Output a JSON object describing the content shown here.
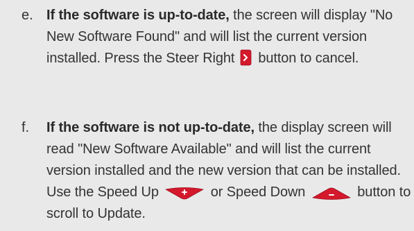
{
  "colors": {
    "background": "#e9e9ea",
    "text": "#333333",
    "button_red": "#d3192b",
    "button_red_dark": "#9e1020",
    "button_symbol": "#ffffff"
  },
  "items": [
    {
      "marker": "e.",
      "bold_lead": "If the software is up-to-date,",
      "text_1": " the screen will display \"No New Software Found\" and will list the current version installed. Press the Steer Right",
      "icon_1": "steer-right-button-icon",
      "text_2": " button to cancel."
    },
    {
      "marker": "f.",
      "bold_lead": "If the software is not up-to-date,",
      "text_1": " the display screen will read \"New Software Available\" and will list the current version installed and the new version that can be installed. Use the Speed Up",
      "icon_1": "speed-up-button-icon",
      "text_2": " or Speed Down",
      "icon_2": "speed-down-button-icon",
      "text_3": " button to scroll to Update."
    }
  ]
}
